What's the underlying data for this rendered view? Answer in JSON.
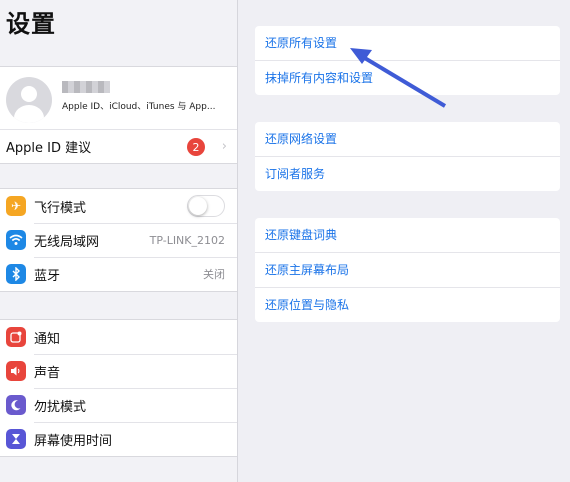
{
  "left": {
    "title": "设置",
    "profile": {
      "subtitle": "Apple ID、iCloud、iTunes 与 App..."
    },
    "suggestion": {
      "label": "Apple ID 建议",
      "badge": "2"
    },
    "connectivity": [
      {
        "label": "飞行模式",
        "icon": "airplane-icon",
        "color": "#f5a623",
        "toggle": false
      },
      {
        "label": "无线局域网",
        "icon": "wifi-icon",
        "color": "#1e88e5",
        "value": "TP-LINK_2102"
      },
      {
        "label": "蓝牙",
        "icon": "bluetooth-icon",
        "color": "#1e88e5",
        "value": "关闭"
      }
    ],
    "notifications": [
      {
        "label": "通知",
        "icon": "notifications-icon",
        "color": "#e8453c"
      },
      {
        "label": "声音",
        "icon": "sound-icon",
        "color": "#e8453c"
      },
      {
        "label": "勿扰模式",
        "icon": "moon-icon",
        "color": "#6a5acd"
      },
      {
        "label": "屏幕使用时间",
        "icon": "hourglass-icon",
        "color": "#5856d6"
      }
    ]
  },
  "right": {
    "group1": [
      "还原所有设置",
      "抹掉所有内容和设置"
    ],
    "group2": [
      "还原网络设置",
      "订阅者服务"
    ],
    "group3": [
      "还原键盘词典",
      "还原主屏幕布局",
      "还原位置与隐私"
    ]
  },
  "annotation": {
    "arrow_color": "#3f5bd6"
  }
}
